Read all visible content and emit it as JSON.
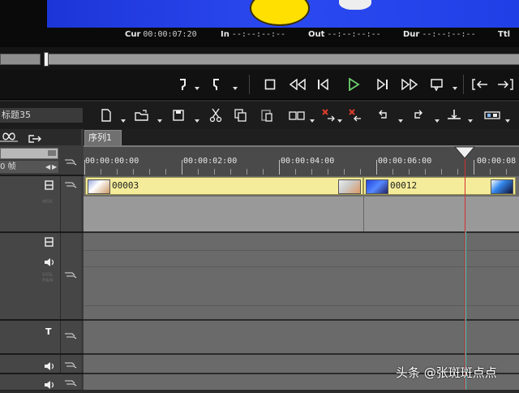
{
  "timecodes": {
    "cur_label": "Cur",
    "cur_value": "00:00:07:20",
    "in_label": "In",
    "in_value": "--:--:--:--",
    "out_label": "Out",
    "out_value": "--:--:--:--",
    "dur_label": "Dur",
    "dur_value": "--:--:--:--",
    "ttl_label": "Ttl"
  },
  "project": {
    "title": "标题35"
  },
  "sequence_tab": {
    "label": "序列1"
  },
  "track_header": {
    "value_prefix": "0",
    "value_unit": "帧"
  },
  "ruler": {
    "labels": [
      "00:00:00:00",
      "00:00:02:00",
      "00:00:04:00",
      "00:00:06:00",
      "00:00:08"
    ]
  },
  "clips": [
    {
      "name": "00003"
    },
    {
      "name": "00012"
    }
  ],
  "track_labels": {
    "mix": "MIX",
    "vol": "VOL",
    "pan": "PAN",
    "title_track_icon": "T"
  },
  "watermark": {
    "prefix": "头条",
    "handle": "@张斑斑点点"
  },
  "colors": {
    "clip_fill": "#f4ec9a",
    "playhead": "#d23030",
    "play_button": "#6cd16c"
  },
  "icons": [
    "mark-in-icon",
    "mark-out-icon",
    "stop-icon",
    "rewind-icon",
    "step-back-icon",
    "play-icon",
    "step-forward-icon",
    "fast-forward-icon",
    "output-icon",
    "goto-in-icon",
    "goto-out-icon",
    "new-icon",
    "open-icon",
    "save-icon",
    "cut-icon",
    "copy-icon",
    "paste-icon",
    "group-icon",
    "delete-icon",
    "ripple-delete-icon",
    "undo-icon",
    "redo-icon",
    "split-icon",
    "speaker-icon"
  ]
}
